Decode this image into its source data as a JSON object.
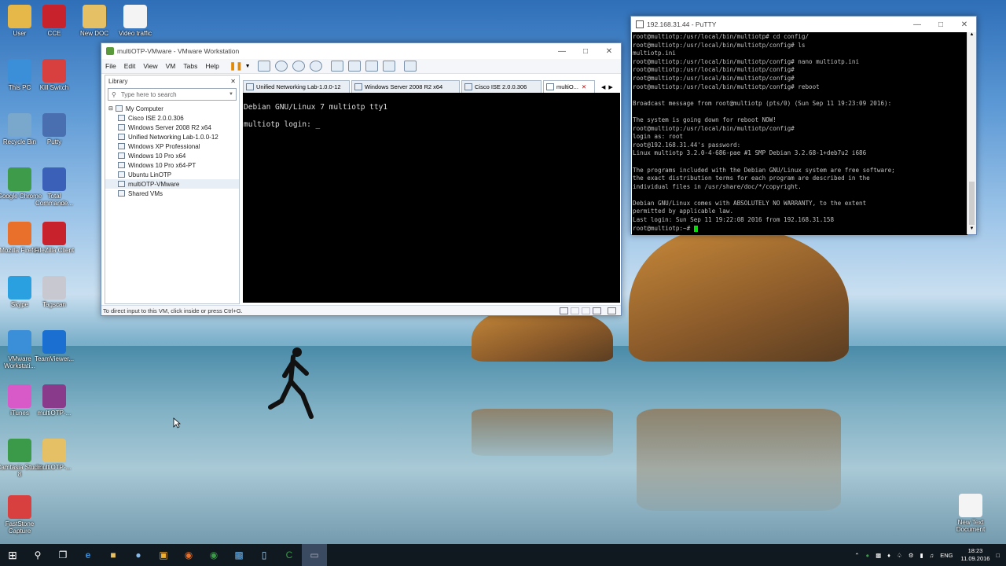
{
  "desktop": {
    "icons": [
      {
        "label": "User",
        "icon": "folder-user-icon",
        "color": "#e6b84a"
      },
      {
        "label": "CCE",
        "icon": "cce-icon",
        "color": "#c8232c"
      },
      {
        "label": "New DOC",
        "icon": "folder-icon",
        "color": "#e6c065"
      },
      {
        "label": "Video traffic",
        "icon": "document-icon",
        "color": "#f4f4f4"
      },
      {
        "label": "This PC",
        "icon": "computer-icon",
        "color": "#3a8fd8"
      },
      {
        "label": "Kill Switch",
        "icon": "network-icon",
        "color": "#d84040"
      },
      {
        "label": "Recycle Bin",
        "icon": "recycle-bin-icon",
        "color": "#7aa7cc"
      },
      {
        "label": "Putty",
        "icon": "putty-icon",
        "color": "#4a6fb0"
      },
      {
        "label": "Google Chrome",
        "icon": "chrome-icon",
        "color": "#3d9b4a"
      },
      {
        "label": "Total Commande...",
        "icon": "total-commander-icon",
        "color": "#3a60b8"
      },
      {
        "label": "Mozilla Firefox",
        "icon": "firefox-icon",
        "color": "#e8702a"
      },
      {
        "label": "FileZilla Client",
        "icon": "filezilla-icon",
        "color": "#c8232c"
      },
      {
        "label": "Skype",
        "icon": "skype-icon",
        "color": "#2aa0e0"
      },
      {
        "label": "Tagscan",
        "icon": "magnifier-icon",
        "color": "#c8c8d0"
      },
      {
        "label": "VMware Workstati...",
        "icon": "vmware-icon",
        "color": "#3a8fd8"
      },
      {
        "label": "TeamViewer...",
        "icon": "teamviewer-icon",
        "color": "#1a6fd0"
      },
      {
        "label": "iTunes",
        "icon": "itunes-icon",
        "color": "#d85ac8"
      },
      {
        "label": "multiOTP-...",
        "icon": "winrar-icon",
        "color": "#8a3a8a"
      },
      {
        "label": "Camtasia Studio 8",
        "icon": "camtasia-icon",
        "color": "#3a9a4a"
      },
      {
        "label": "multiOTP-...",
        "icon": "folder-icon",
        "color": "#e6c065"
      },
      {
        "label": "FastStone Capture",
        "icon": "faststone-icon",
        "color": "#d84040"
      },
      {
        "label": "New Text Document",
        "icon": "text-document-icon",
        "color": "#f4f4f4"
      }
    ]
  },
  "vmware": {
    "title": "multiOTP-VMware - VMware Workstation",
    "menu": [
      "File",
      "Edit",
      "View",
      "VM",
      "Tabs",
      "Help"
    ],
    "library": {
      "title": "Library",
      "search_placeholder": "Type here to search",
      "root": "My Computer",
      "vms": [
        "Cisco ISE 2.0.0.306",
        "Windows Server 2008 R2 x64",
        "Unified Networking Lab-1.0.0-12",
        "Windows XP Professional",
        "Windows 10 Pro x64",
        "Windows 10 Pro x64-PT",
        "Ubuntu LinOTP",
        "multiOTP-VMware"
      ],
      "shared": "Shared VMs"
    },
    "tabs": [
      "Unified Networking Lab-1.0.0-12",
      "Windows Server 2008 R2 x64",
      "Cisco ISE 2.0.0.306",
      "multiO..."
    ],
    "console": {
      "line1": "Debian GNU/Linux 7 multiotp tty1",
      "line2": "multiotp login: _"
    },
    "status": "To direct input to this VM, click inside or press Ctrl+G."
  },
  "putty": {
    "title": "192.168.31.44 - PuTTY",
    "lines": [
      "root@multiotp:/usr/local/bin/multiotp# cd config/",
      "root@multiotp:/usr/local/bin/multiotp/config# ls",
      "multiotp.ini",
      "root@multiotp:/usr/local/bin/multiotp/config# nano multiotp.ini",
      "root@multiotp:/usr/local/bin/multiotp/config#",
      "root@multiotp:/usr/local/bin/multiotp/config#",
      "root@multiotp:/usr/local/bin/multiotp/config# reboot",
      "",
      "Broadcast message from root@multiotp (pts/0) (Sun Sep 11 19:23:09 2016):",
      "",
      "The system is going down for reboot NOW!",
      "root@multiotp:/usr/local/bin/multiotp/config#",
      "login as: root",
      "root@192.168.31.44's password:",
      "Linux multiotp 3.2.0-4-686-pae #1 SMP Debian 3.2.68-1+deb7u2 i686",
      "",
      "The programs included with the Debian GNU/Linux system are free software;",
      "the exact distribution terms for each program are described in the",
      "individual files in /usr/share/doc/*/copyright.",
      "",
      "Debian GNU/Linux comes with ABSOLUTELY NO WARRANTY, to the extent",
      "permitted by applicable law.",
      "Last login: Sun Sep 11 19:22:08 2016 from 192.168.31.158",
      "root@multiotp:~# "
    ]
  },
  "taskbar": {
    "language": "ENG",
    "time": "18:23",
    "date": "11.09.2016"
  }
}
